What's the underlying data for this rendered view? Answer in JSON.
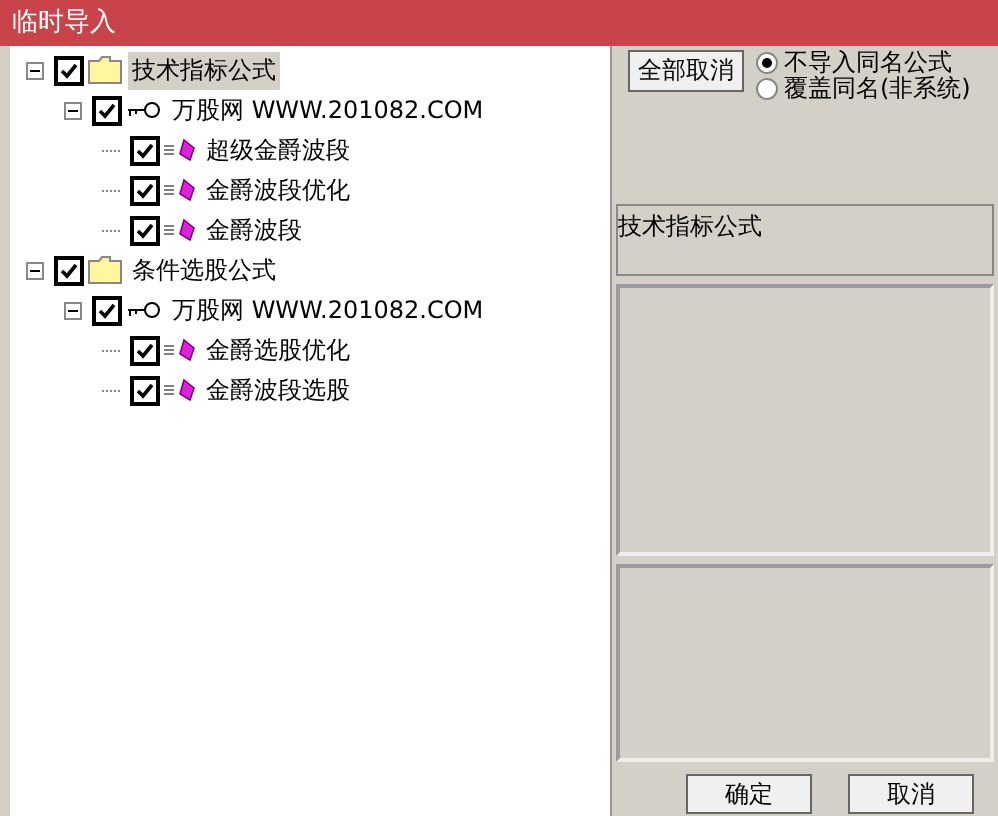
{
  "window": {
    "title": "临时导入"
  },
  "tree": [
    {
      "label": "技术指标公式",
      "kind": "folder",
      "checked": true,
      "expanded": true,
      "selected": true,
      "children": [
        {
          "label": "万股网 WWW.201082.COM",
          "kind": "key",
          "checked": true,
          "expanded": true,
          "selected": false,
          "children": [
            {
              "label": "超级金爵波段",
              "kind": "formula",
              "checked": true,
              "selected": false
            },
            {
              "label": "金爵波段优化",
              "kind": "formula",
              "checked": true,
              "selected": false
            },
            {
              "label": "金爵波段",
              "kind": "formula",
              "checked": true,
              "selected": false
            }
          ]
        }
      ]
    },
    {
      "label": "条件选股公式",
      "kind": "folder",
      "checked": true,
      "expanded": true,
      "selected": false,
      "children": [
        {
          "label": "万股网 WWW.201082.COM",
          "kind": "key",
          "checked": true,
          "expanded": true,
          "selected": false,
          "children": [
            {
              "label": "金爵选股优化",
              "kind": "formula",
              "checked": true,
              "selected": false
            },
            {
              "label": "金爵波段选股",
              "kind": "formula",
              "checked": true,
              "selected": false
            }
          ]
        }
      ]
    }
  ],
  "toggle_button": "全部取消",
  "options": [
    {
      "label": "不导入同名公式",
      "selected": true
    },
    {
      "label": "覆盖同名(非系统)",
      "selected": false
    }
  ],
  "description": "技术指标公式",
  "buttons": [
    "确定",
    "取消"
  ]
}
